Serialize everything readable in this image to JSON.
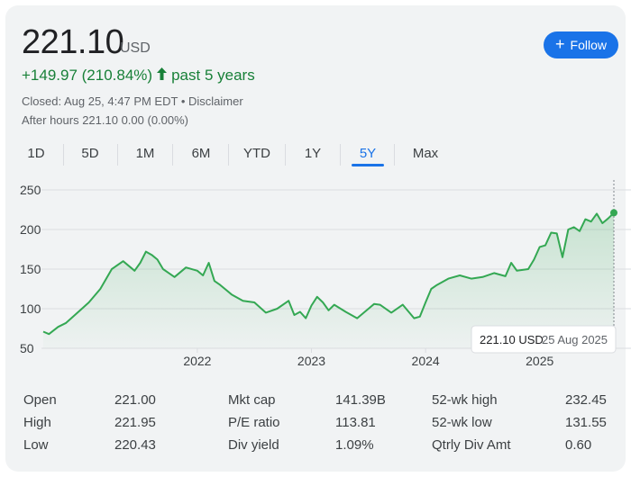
{
  "quote": {
    "price": "221.10",
    "currency": "USD",
    "follow_label": "Follow",
    "change": "+149.97 (210.84%)",
    "change_period": "past 5 years",
    "closed_text": "Closed: Aug 25, 4:47 PM EDT",
    "separator": " • ",
    "disclaimer": "Disclaimer",
    "after_hours": "After hours 221.10 0.00 (0.00%)"
  },
  "tabs": [
    "1D",
    "5D",
    "1M",
    "6M",
    "YTD",
    "1Y",
    "5Y",
    "Max"
  ],
  "active_tab": "5Y",
  "colors": {
    "accent": "#1a73e8",
    "positive": "#188038",
    "line": "#34a853"
  },
  "tooltip": {
    "price": "221.10 USD",
    "date": "25 Aug 2025"
  },
  "chart_data": {
    "type": "area",
    "y_ticks": [
      "250",
      "200",
      "150",
      "100",
      "50"
    ],
    "x_ticks": [
      "2022",
      "2023",
      "2024",
      "2025"
    ],
    "ylim": [
      50,
      250
    ],
    "xlim": [
      2020.65,
      2025.65
    ],
    "grid": true,
    "x": [
      2020.65,
      2020.7,
      2020.78,
      2020.85,
      2020.95,
      2021.05,
      2021.15,
      2021.25,
      2021.35,
      2021.45,
      2021.5,
      2021.55,
      2021.6,
      2021.65,
      2021.7,
      2021.75,
      2021.8,
      2021.9,
      2022.0,
      2022.05,
      2022.1,
      2022.15,
      2022.2,
      2022.3,
      2022.4,
      2022.5,
      2022.6,
      2022.7,
      2022.8,
      2022.85,
      2022.9,
      2022.95,
      2023.0,
      2023.05,
      2023.1,
      2023.15,
      2023.2,
      2023.3,
      2023.4,
      2023.5,
      2023.55,
      2023.6,
      2023.7,
      2023.8,
      2023.9,
      2023.95,
      2024.0,
      2024.05,
      2024.1,
      2024.2,
      2024.3,
      2024.4,
      2024.5,
      2024.6,
      2024.7,
      2024.75,
      2024.8,
      2024.9,
      2024.95,
      2025.0,
      2025.05,
      2025.1,
      2025.15,
      2025.2,
      2025.25,
      2025.3,
      2025.35,
      2025.4,
      2025.45,
      2025.5,
      2025.55,
      2025.6,
      2025.65
    ],
    "y": [
      71,
      68,
      77,
      82,
      95,
      108,
      125,
      150,
      160,
      148,
      158,
      172,
      168,
      162,
      150,
      145,
      140,
      152,
      148,
      142,
      158,
      135,
      130,
      118,
      110,
      108,
      95,
      100,
      110,
      92,
      96,
      88,
      104,
      115,
      108,
      98,
      105,
      96,
      88,
      100,
      106,
      105,
      95,
      105,
      88,
      90,
      108,
      125,
      130,
      138,
      142,
      138,
      140,
      145,
      141,
      158,
      148,
      150,
      162,
      178,
      180,
      196,
      195,
      165,
      200,
      203,
      198,
      213,
      210,
      220,
      208,
      214,
      221.1
    ]
  },
  "stats": [
    {
      "label": "Open",
      "value": "221.00"
    },
    {
      "label": "High",
      "value": "221.95"
    },
    {
      "label": "Low",
      "value": "220.43"
    },
    {
      "label": "Mkt cap",
      "value": "141.39B"
    },
    {
      "label": "P/E ratio",
      "value": "113.81"
    },
    {
      "label": "Div yield",
      "value": "1.09%"
    },
    {
      "label": "52-wk high",
      "value": "232.45"
    },
    {
      "label": "52-wk low",
      "value": "131.55"
    },
    {
      "label": "Qtrly Div Amt",
      "value": "0.60"
    }
  ]
}
